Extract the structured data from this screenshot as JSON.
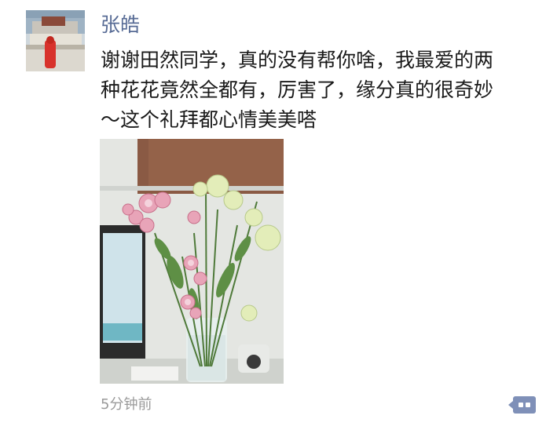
{
  "post": {
    "author": "张皓",
    "text_lines": [
      "谢谢田然同学，真的没有帮你啥，我最爱的两",
      "种花花竟然全都有，厉害了，缘分真的很奇妙",
      "～这个礼拜都心情美美嗒"
    ],
    "timestamp": "5分钟前",
    "accent_color": "#576b95",
    "action_icon": "more-dots-icon"
  }
}
